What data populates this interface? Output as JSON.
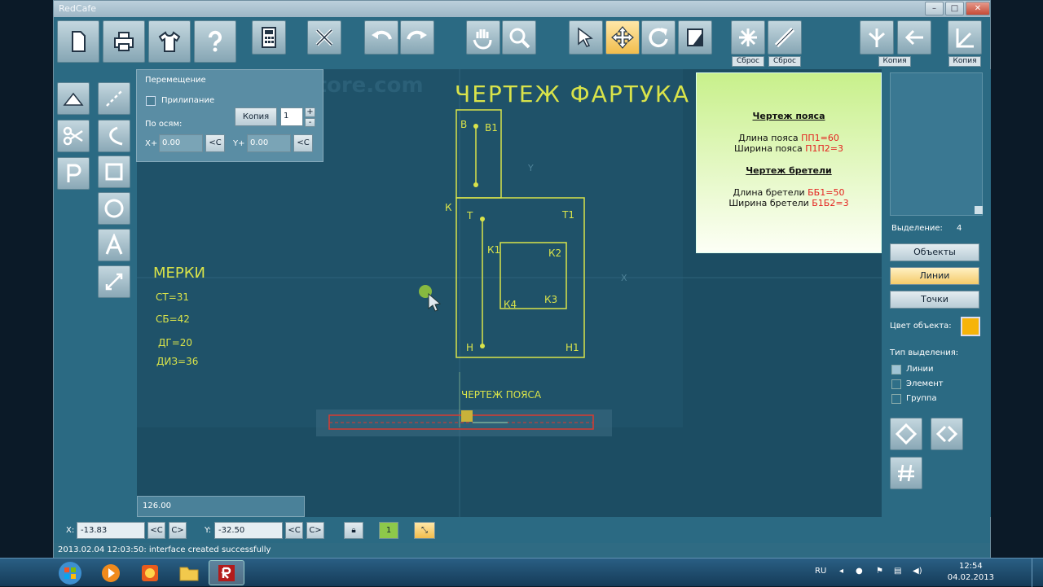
{
  "window": {
    "title": "RedCafe",
    "min": "–",
    "max": "□",
    "close": "✕"
  },
  "toolbar": {
    "reset1": "Сброс",
    "reset2": "Сброс",
    "copy": "Копия",
    "copy2": "Копия",
    "field_value": "1"
  },
  "panel": {
    "title": "Перемещение",
    "snap": "Прилипание",
    "copy_button": "Копия",
    "copy_count": "1",
    "inc": "+",
    "dec": "-",
    "axes_label": "По осям:",
    "x_label": "X+",
    "x_value": "0.00",
    "x_btn": "<C",
    "y_label": "Y+",
    "y_value": "0.00",
    "y_btn": "<C"
  },
  "drawing": {
    "title": "ЧЕРТЕЖ ФАРТУКА",
    "watermark": "RedCafeStore.com",
    "measures_title": "МЕРКИ",
    "m1": "СТ=31",
    "m2": "СБ=42",
    "m3": "ДГ=20",
    "m4": "ДИЗ=36",
    "belt_label": "ЧЕРТЕЖ ПОЯСА",
    "points": {
      "B": "В",
      "B1": "В1",
      "K": "К",
      "T": "Т",
      "T1": "Т1",
      "K1": "К1",
      "K2": "К2",
      "K3": "К3",
      "K4": "К4",
      "H": "Н",
      "H1": "Н1"
    },
    "axis_y": "Y",
    "axis_x": "X"
  },
  "info": {
    "h1": "Чертеж пояса",
    "l1": "Длина пояса ",
    "v1": "ПП1=60",
    "l2": "Ширина пояса ",
    "v2": "П1П2=3",
    "h2": "Чертеж бретели",
    "l3": "Длина бретели ",
    "v3": "ББ1=50",
    "l4": "Ширина бретели ",
    "v4": "Б1Б2=3"
  },
  "right": {
    "selection_label": "Выделение:",
    "selection_count": "4",
    "objects": "Объекты",
    "lines": "Линии",
    "points": "Точки",
    "color_label": "Цвет объекта:",
    "color": "#f6b40a",
    "sel_type_label": "Тип выделения:",
    "opt_lines": "Линии",
    "opt_element": "Элемент",
    "opt_group": "Группа"
  },
  "status": {
    "x_label": "X:",
    "x_value": "-13.83",
    "btn_prev": "<C",
    "btn_next": "C>",
    "y_label": "Y:",
    "y_value": "-32.50",
    "layer": "1",
    "value_box": "126.00"
  },
  "log": "2013.02.04 12:03:50: interface created successfully",
  "taskbar": {
    "lang": "RU",
    "time": "12:54",
    "date": "04.02.2013"
  }
}
